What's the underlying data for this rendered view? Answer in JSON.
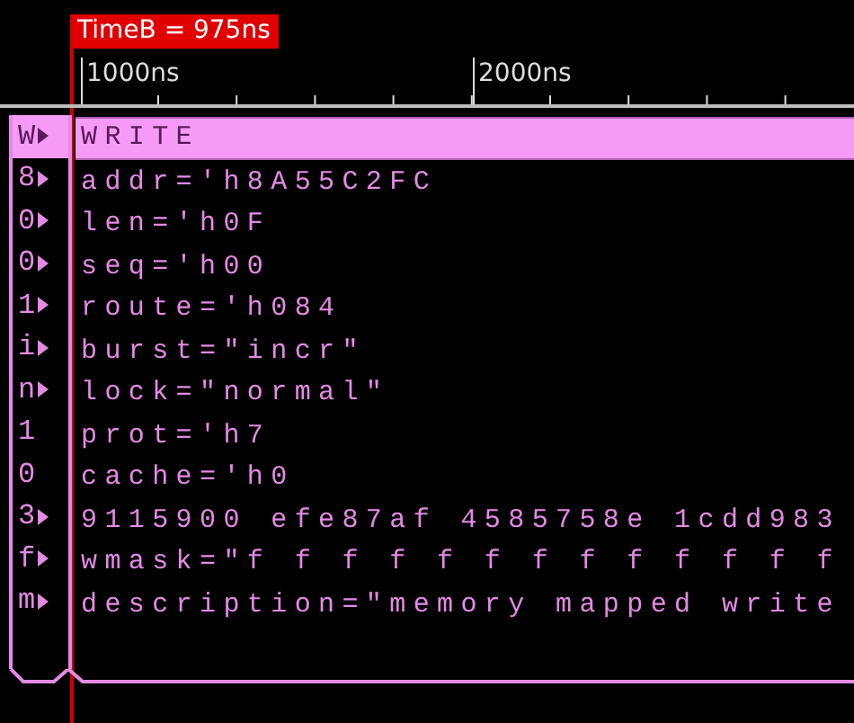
{
  "marker": {
    "label": "TimeB = 975ns"
  },
  "ruler": {
    "ticks": [
      "1000ns",
      "2000ns"
    ]
  },
  "header": {
    "prefix": "W",
    "expandable": true,
    "label": "WRITE"
  },
  "fields": [
    {
      "prefix": "8",
      "expandable": true,
      "text": "addr='h8A55C2FC"
    },
    {
      "prefix": "0",
      "expandable": true,
      "text": "len='h0F"
    },
    {
      "prefix": "0",
      "expandable": true,
      "text": "seq='h00"
    },
    {
      "prefix": "1",
      "expandable": true,
      "text": "route='h084"
    },
    {
      "prefix": "i",
      "expandable": true,
      "text": "burst=\"incr\""
    },
    {
      "prefix": "n",
      "expandable": true,
      "text": "lock=\"normal\""
    },
    {
      "prefix": "1",
      "expandable": false,
      "text": "prot='h7"
    },
    {
      "prefix": "0",
      "expandable": false,
      "text": "cache='h0"
    },
    {
      "prefix": "3",
      "expandable": true,
      "text": "9115900 efe87af 4585758e 1cdd983"
    },
    {
      "prefix": "f",
      "expandable": true,
      "text": "wmask=\"f f f f f f f f f f f f f"
    },
    {
      "prefix": "m",
      "expandable": true,
      "text": "description=\"memory mapped write"
    }
  ]
}
